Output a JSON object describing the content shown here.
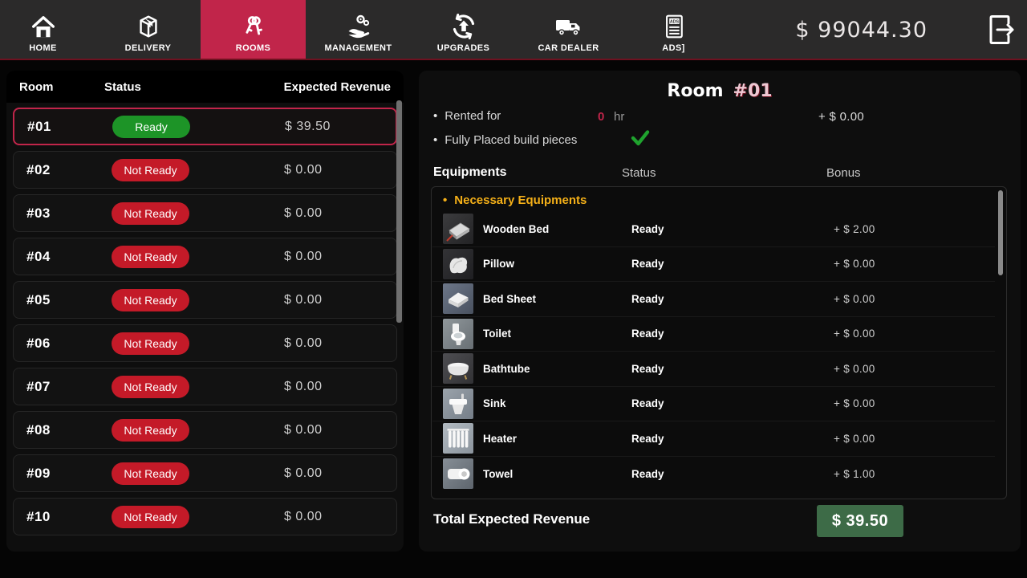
{
  "colors": {
    "accent_red": "#c1254a",
    "ready_green": "#1d9427",
    "not_ready_red": "#c41a28",
    "necessary_amber": "#f5b018",
    "total_green": "#3d6b47"
  },
  "nav": {
    "tabs": [
      {
        "label": "HOME",
        "icon": "home-icon",
        "active": false
      },
      {
        "label": "DELIVERY",
        "icon": "delivery-box-icon",
        "active": false
      },
      {
        "label": "ROOMS",
        "icon": "keys-icon",
        "active": true
      },
      {
        "label": "MANAGEMENT",
        "icon": "hand-gears-icon",
        "active": false
      },
      {
        "label": "UPGRADES",
        "icon": "upgrade-cycle-icon",
        "active": false
      },
      {
        "label": "CAR DEALER",
        "icon": "truck-icon",
        "active": false
      },
      {
        "label": "ADS]",
        "icon": "newspaper-ads-icon",
        "active": false
      }
    ],
    "balance": "$ 99044.30",
    "exit_icon": "exit-door-icon"
  },
  "room_list": {
    "headers": {
      "room": "Room",
      "status": "Status",
      "revenue": "Expected Revenue"
    },
    "rows": [
      {
        "id": "#01",
        "status": "Ready",
        "revenue": "$ 39.50",
        "selected": true
      },
      {
        "id": "#02",
        "status": "Not Ready",
        "revenue": "$ 0.00",
        "selected": false
      },
      {
        "id": "#03",
        "status": "Not Ready",
        "revenue": "$ 0.00",
        "selected": false
      },
      {
        "id": "#04",
        "status": "Not Ready",
        "revenue": "$ 0.00",
        "selected": false
      },
      {
        "id": "#05",
        "status": "Not Ready",
        "revenue": "$ 0.00",
        "selected": false
      },
      {
        "id": "#06",
        "status": "Not Ready",
        "revenue": "$ 0.00",
        "selected": false
      },
      {
        "id": "#07",
        "status": "Not Ready",
        "revenue": "$ 0.00",
        "selected": false
      },
      {
        "id": "#08",
        "status": "Not Ready",
        "revenue": "$ 0.00",
        "selected": false
      },
      {
        "id": "#09",
        "status": "Not Ready",
        "revenue": "$ 0.00",
        "selected": false
      },
      {
        "id": "#10",
        "status": "Not Ready",
        "revenue": "$ 0.00",
        "selected": false
      }
    ]
  },
  "room_detail": {
    "title_label": "Room",
    "title_number": "#01",
    "rented": {
      "bullet": "•",
      "label": "Rented for",
      "value": "0",
      "unit": "hr",
      "bonus": "+ $ 0.00"
    },
    "build": {
      "bullet": "•",
      "label": "Fully Placed build pieces",
      "check_icon": "green-check-icon"
    },
    "table_headers": {
      "equipments": "Equipments",
      "status": "Status",
      "bonus": "Bonus"
    },
    "group_bullet": "•",
    "group_label": "Necessary Equipments",
    "equipment": [
      {
        "name": "Wooden Bed",
        "status": "Ready",
        "bonus": "+ $ 2.00",
        "icon": "wooden-bed-thumb"
      },
      {
        "name": "Pillow",
        "status": "Ready",
        "bonus": "+ $ 0.00",
        "icon": "pillow-thumb"
      },
      {
        "name": "Bed Sheet",
        "status": "Ready",
        "bonus": "+ $ 0.00",
        "icon": "bed-sheet-thumb"
      },
      {
        "name": "Toilet",
        "status": "Ready",
        "bonus": "+ $ 0.00",
        "icon": "toilet-thumb"
      },
      {
        "name": "Bathtube",
        "status": "Ready",
        "bonus": "+ $ 0.00",
        "icon": "bathtub-thumb"
      },
      {
        "name": "Sink",
        "status": "Ready",
        "bonus": "+ $ 0.00",
        "icon": "sink-thumb"
      },
      {
        "name": "Heater",
        "status": "Ready",
        "bonus": "+ $ 0.00",
        "icon": "heater-thumb"
      },
      {
        "name": "Towel",
        "status": "Ready",
        "bonus": "+ $ 1.00",
        "icon": "towel-thumb"
      }
    ],
    "total_label": "Total Expected Revenue",
    "total_value": "$ 39.50"
  }
}
